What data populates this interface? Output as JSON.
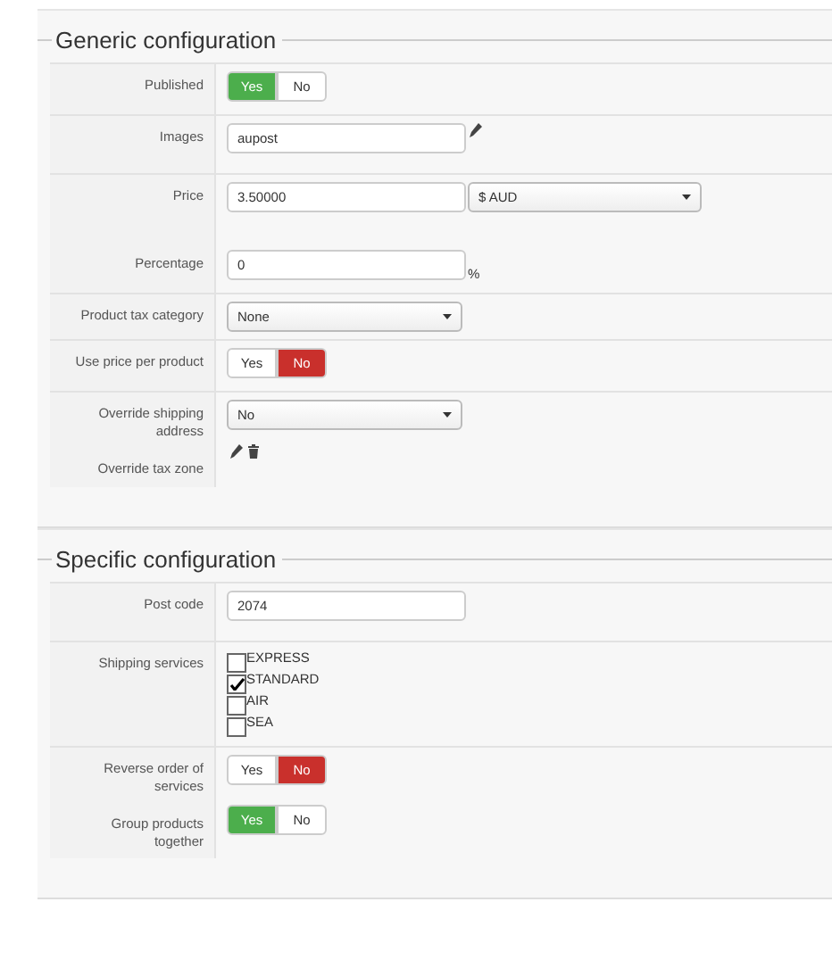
{
  "sections": [
    {
      "title": "Generic configuration",
      "groups": [
        {
          "fields": [
            {
              "kind": "toggle",
              "label": "Published",
              "options": [
                {
                  "label": "Yes",
                  "selected": true
                },
                {
                  "label": "No",
                  "selected": false
                }
              ]
            }
          ]
        },
        {
          "fields": [
            {
              "kind": "text_edit",
              "label": "Images",
              "value": "aupost"
            }
          ]
        },
        {
          "fields": [
            {
              "kind": "text_select",
              "label": "Price",
              "value": "3.50000",
              "select": "$ AUD"
            },
            {
              "kind": "text_suffix",
              "label": "Percentage",
              "value": "0",
              "suffix": "%"
            }
          ]
        },
        {
          "fields": [
            {
              "kind": "select",
              "label": "Product tax category",
              "select": "None"
            }
          ]
        },
        {
          "fields": [
            {
              "kind": "toggle",
              "label": "Use price per product",
              "options": [
                {
                  "label": "Yes",
                  "selected": false
                },
                {
                  "label": "No",
                  "selected": true
                }
              ]
            }
          ]
        },
        {
          "fields": [
            {
              "kind": "select",
              "label": "Override shipping address",
              "select": "No"
            },
            {
              "kind": "icons",
              "label": "Override tax zone"
            }
          ]
        }
      ]
    },
    {
      "title": "Specific configuration",
      "groups": [
        {
          "fields": [
            {
              "kind": "text",
              "label": "Post code",
              "value": "2074"
            }
          ]
        },
        {
          "fields": [
            {
              "kind": "checkboxes",
              "label": "Shipping services",
              "items": [
                {
                  "label": "EXPRESS",
                  "checked": false
                },
                {
                  "label": "STANDARD",
                  "checked": true
                },
                {
                  "label": "AIR",
                  "checked": false
                },
                {
                  "label": "SEA",
                  "checked": false
                }
              ]
            }
          ]
        },
        {
          "fields": [
            {
              "kind": "toggle",
              "label": "Reverse order of services",
              "options": [
                {
                  "label": "Yes",
                  "selected": false
                },
                {
                  "label": "No",
                  "selected": true
                }
              ]
            },
            {
              "kind": "toggle",
              "label": "Group products together",
              "options": [
                {
                  "label": "Yes",
                  "selected": true
                },
                {
                  "label": "No",
                  "selected": false
                }
              ]
            }
          ]
        }
      ]
    }
  ]
}
